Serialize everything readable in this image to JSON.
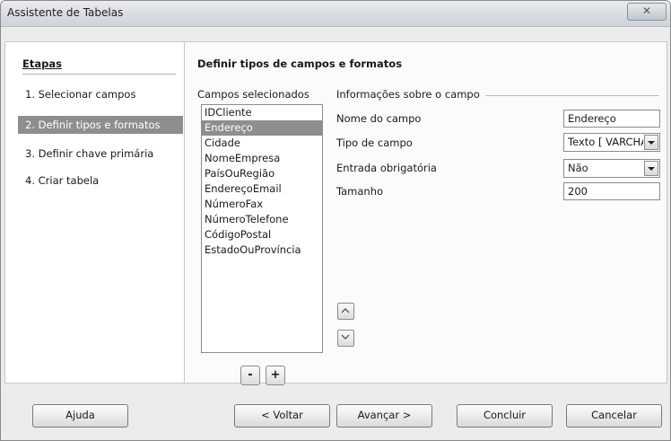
{
  "window": {
    "title": "Assistente de Tabelas",
    "close_glyph": "✕"
  },
  "steps": {
    "heading": "Etapas",
    "items": [
      {
        "label": "1.  Selecionar campos",
        "active": false
      },
      {
        "label": "2.  Definir tipos e formatos",
        "active": true
      },
      {
        "label": "3.  Definir chave primária",
        "active": false
      },
      {
        "label": "4.  Criar tabela",
        "active": false
      }
    ]
  },
  "page": {
    "title": "Definir tipos de campos e formatos"
  },
  "fields": {
    "label": "Campos selecionados",
    "items": [
      "IDCliente",
      "Endereço",
      "Cidade",
      "NomeEmpresa",
      "PaísOuRegião",
      "EndereçoEmail",
      "NúmeroFax",
      "NúmeroTelefone",
      "CódigoPostal",
      "EstadoOuProvíncia"
    ],
    "selected_index": 1,
    "remove_label": "-",
    "add_label": "+"
  },
  "field_info": {
    "group_title": "Informações sobre o campo",
    "name_label": "Nome do campo",
    "name_value": "Endereço",
    "type_label": "Tipo de campo",
    "type_value": "Texto [ VARCHAR ]",
    "required_label": "Entrada obrigatória",
    "required_value": "Não",
    "size_label": "Tamanho",
    "size_value": "200"
  },
  "footer": {
    "help_label": "Ajuda",
    "back_label": "< Voltar",
    "next_label": "Avançar >",
    "finish_label": "Concluir",
    "cancel_label": "Cancelar"
  },
  "icons": {
    "move_up": "chevron-up-icon",
    "move_down": "chevron-down-icon",
    "close": "close-icon"
  }
}
